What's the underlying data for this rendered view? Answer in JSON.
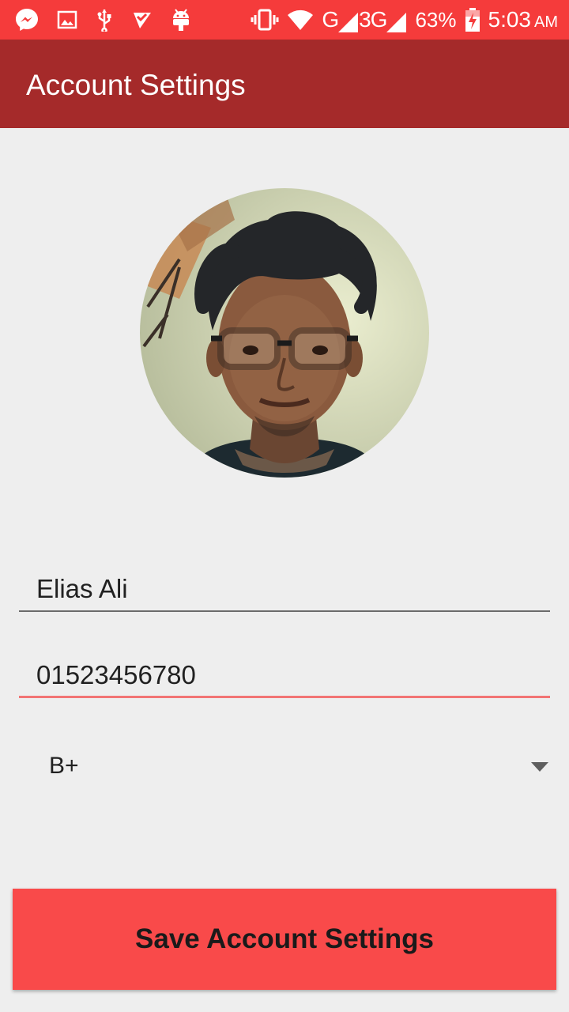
{
  "status_bar": {
    "network_label": "G",
    "network_label_2": "3G",
    "battery_percent": "63%",
    "time": "5:03",
    "ampm": "AM",
    "background_color": "#f53b3b",
    "icons": [
      "messenger-icon",
      "gallery-icon",
      "usb-icon",
      "checklist-icon",
      "android-icon",
      "vibrate-icon",
      "wifi-icon",
      "signal-icon",
      "battery-charging-icon"
    ]
  },
  "app_bar": {
    "title": "Account Settings",
    "background_color": "#a52a2a"
  },
  "profile": {
    "avatar": "profile-photo"
  },
  "form": {
    "name_value": "Elias Ali",
    "phone_value": "01523456780",
    "blood_group_value": "B+"
  },
  "actions": {
    "save_label": "Save Account Settings",
    "save_color": "#f94a4a"
  }
}
